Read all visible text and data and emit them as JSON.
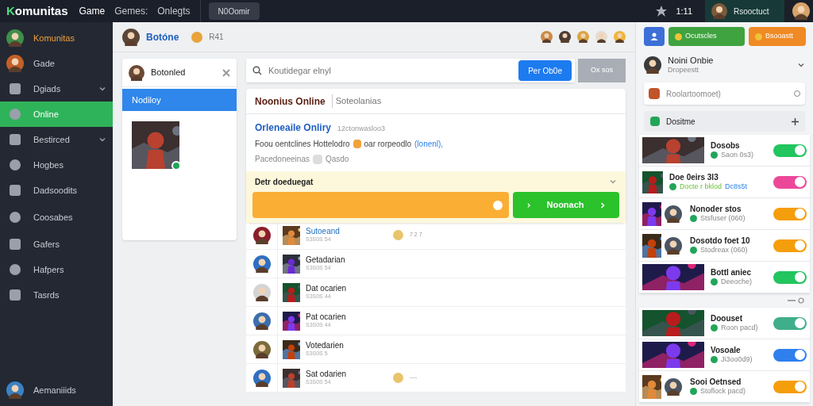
{
  "topbar": {
    "logo": "Komunitas",
    "nav": [
      {
        "label": "Game",
        "selected": true
      },
      {
        "label": "Gemes:",
        "selected": false
      },
      {
        "label": "Onlegts",
        "selected": false
      }
    ],
    "button": "N0Oomir",
    "rating": "1:11",
    "user": "Rsooctuct"
  },
  "sidebar": {
    "items": [
      {
        "label": "Komunitas",
        "kind": "avatar",
        "selected": false,
        "expandable": false
      },
      {
        "label": "Gade",
        "kind": "avatar",
        "selected": false,
        "expandable": false
      },
      {
        "label": "Dgiads",
        "kind": "icon",
        "selected": false,
        "expandable": true
      },
      {
        "label": "Online",
        "kind": "icon",
        "selected": true,
        "expandable": false
      },
      {
        "label": "Bestirced",
        "kind": "icon",
        "selected": false,
        "expandable": true
      },
      {
        "label": "Hogbes",
        "kind": "icon",
        "selected": false,
        "expandable": false
      },
      {
        "label": "Dadsoodits",
        "kind": "icon",
        "selected": false,
        "expandable": false
      },
      {
        "label": "Coosabes",
        "kind": "icon",
        "selected": false,
        "expandable": false
      },
      {
        "label": "Gafers",
        "kind": "icon",
        "selected": false,
        "expandable": false
      },
      {
        "label": "Hafpers",
        "kind": "icon",
        "selected": false,
        "expandable": false
      },
      {
        "label": "Tasrds",
        "kind": "icon",
        "selected": false,
        "expandable": false
      }
    ],
    "footer": "Aemaniiids"
  },
  "header": {
    "title": "Botóne",
    "coins": "R41"
  },
  "side_card": {
    "title": "Botonled",
    "items": [
      {
        "label": "Nodiloy",
        "selected": true
      }
    ]
  },
  "search": {
    "placeholder": "Koutidegar elnyl",
    "button": "Per Ob0e",
    "secondary": "Ox sos"
  },
  "panel": {
    "title": "Noonius Online",
    "subtitle": "Soteolanias",
    "heading": "Orleneaile Onliry",
    "heading_note": "12ctonwasloo3",
    "line1": "Foou oentclines Hottelodro",
    "line1_after": "oar rorpeodlo",
    "line1_link": "(lonenl),",
    "line2": "Pacedoneeinas",
    "line2_after": "Qasdo",
    "section": "Detr doeduegat",
    "expanded": true,
    "action": "Noonach"
  },
  "list": [
    {
      "title": "Sutoeand",
      "sub": "S3S0S 54",
      "highlight": true,
      "extra": "7 2 7"
    },
    {
      "title": "Getadarian",
      "sub": "S3S0S 54",
      "highlight": false
    },
    {
      "title": "Dat ocarien",
      "sub": "S3S0S 44",
      "highlight": false
    },
    {
      "title": "Pat ocarien",
      "sub": "S3S0S 44",
      "highlight": false
    },
    {
      "title": "Votedarien",
      "sub": "S3S0S 5",
      "highlight": false
    },
    {
      "title": "Sat odarien",
      "sub": "S3S0S 54",
      "highlight": false,
      "extra": "----"
    }
  ],
  "right": {
    "buttons": [
      "Ocutscles",
      "Bsooastt"
    ],
    "profile": {
      "name": "Noini Onbie",
      "status": "Dropeestt"
    },
    "field": {
      "placeholder": "Roolartoomoet)"
    },
    "section": "Dositme",
    "games": [
      {
        "title": "Dosobs",
        "sub": "Saon 0s3)",
        "on": true,
        "color": "#22c55e",
        "kind": "banner"
      },
      {
        "title": "Doe 0eirs 3l3",
        "sub": "Docte r bklod",
        "sub2": "Dc8s5t",
        "on": true,
        "color": "#ec4899",
        "kind": "thumb"
      },
      {
        "title": "Nonoder stos",
        "sub": "Stsfuser (060)",
        "on": true,
        "color": "#f59e0b",
        "kind": "pair"
      },
      {
        "title": "Dosotdo foet 10",
        "sub": "Stodreax (060)",
        "on": true,
        "color": "#f59e0b",
        "kind": "pair"
      },
      {
        "title": "Bottl aniec",
        "sub": "Deeoche)",
        "on": true,
        "color": "#22c55e",
        "kind": "banner"
      }
    ],
    "games2": [
      {
        "title": "Doouset",
        "sub": "Roon pacd)",
        "on": true,
        "color": "#3fae8a",
        "kind": "banner"
      },
      {
        "title": "Vosoale",
        "sub": "Ji3oo0d9)",
        "on": true,
        "color": "#2f80ed",
        "kind": "banner"
      },
      {
        "title": "Sooi Oetnsed",
        "sub": "Stoflock pacd)",
        "on": true,
        "color": "#f59e0b",
        "kind": "pair"
      }
    ]
  }
}
